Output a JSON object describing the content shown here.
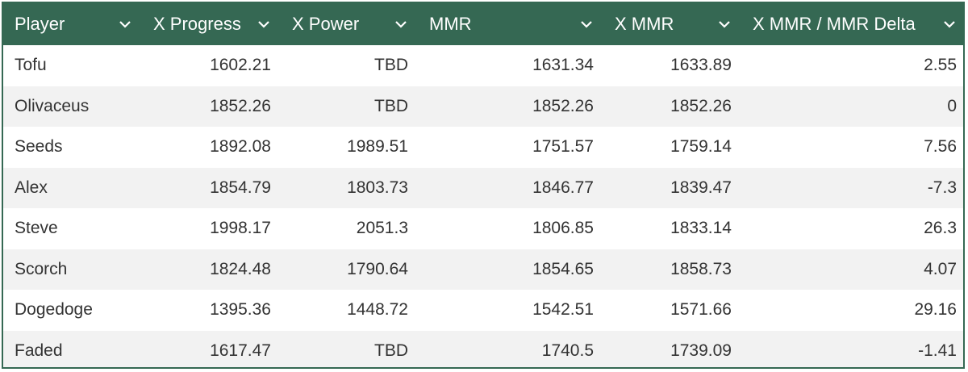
{
  "table": {
    "columns": [
      {
        "label": "Player",
        "icon": "chevron-down-icon"
      },
      {
        "label": "X Progress",
        "icon": "chevron-down-icon"
      },
      {
        "label": "X Power",
        "icon": "chevron-down-icon"
      },
      {
        "label": "MMR",
        "icon": "chevron-down-icon"
      },
      {
        "label": "X MMR",
        "icon": "chevron-down-icon"
      },
      {
        "label": "X MMR / MMR Delta",
        "icon": "chevron-down-icon"
      }
    ],
    "rows": [
      [
        "Tofu",
        "1602.21",
        "TBD",
        "1631.34",
        "1633.89",
        "2.55"
      ],
      [
        "Olivaceus",
        "1852.26",
        "TBD",
        "1852.26",
        "1852.26",
        "0"
      ],
      [
        "Seeds",
        "1892.08",
        "1989.51",
        "1751.57",
        "1759.14",
        "7.56"
      ],
      [
        "Alex",
        "1854.79",
        "1803.73",
        "1846.77",
        "1839.47",
        "-7.3"
      ],
      [
        "Steve",
        "1998.17",
        "2051.3",
        "1806.85",
        "1833.14",
        "26.3"
      ],
      [
        "Scorch",
        "1824.48",
        "1790.64",
        "1854.65",
        "1858.73",
        "4.07"
      ],
      [
        "Dogedoge",
        "1395.36",
        "1448.72",
        "1542.51",
        "1571.66",
        "29.16"
      ],
      [
        "Faded",
        "1617.47",
        "TBD",
        "1740.5",
        "1739.09",
        "-1.41"
      ]
    ]
  },
  "colors": {
    "header_bg": "#356853",
    "header_text": "#ffffff",
    "row_alt_bg": "#f2f2f2",
    "cell_text": "#333333"
  }
}
